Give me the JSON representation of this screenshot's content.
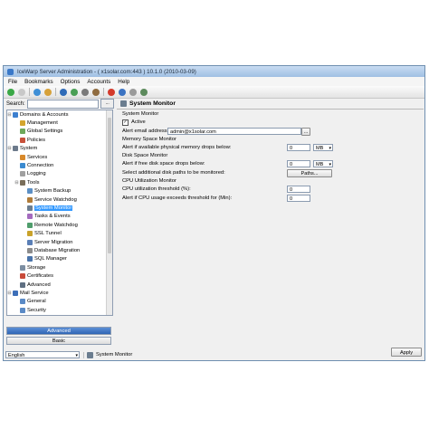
{
  "window": {
    "title": "IceWarp Server Administration - ( x1solar.com:443 ) 10.1.0 (2010-03-09)"
  },
  "menu": [
    "File",
    "Bookmarks",
    "Options",
    "Accounts",
    "Help"
  ],
  "search": {
    "label": "Search:",
    "button": "..."
  },
  "tree": [
    {
      "label": "Domains & Accounts",
      "exp": "⊟",
      "icon": "#3c7fcf",
      "indent": 0
    },
    {
      "label": "Management",
      "exp": "",
      "icon": "#d4a52e",
      "indent": 2
    },
    {
      "label": "Global Settings",
      "exp": "",
      "icon": "#6fa85a",
      "indent": 2
    },
    {
      "label": "Policies",
      "exp": "",
      "icon": "#c8513a",
      "indent": 2
    },
    {
      "label": "System",
      "exp": "⊟",
      "icon": "#6c7a8b",
      "indent": 0
    },
    {
      "label": "Services",
      "exp": "",
      "icon": "#d8892a",
      "indent": 2
    },
    {
      "label": "Connection",
      "exp": "",
      "icon": "#3a8ad0",
      "indent": 2
    },
    {
      "label": "Logging",
      "exp": "",
      "icon": "#a0a0a0",
      "indent": 2
    },
    {
      "label": "Tools",
      "exp": "⊟",
      "icon": "#7a6e5a",
      "indent": 2
    },
    {
      "label": "System Backup",
      "exp": "",
      "icon": "#5c8fc4",
      "indent": 4
    },
    {
      "label": "Service Watchdog",
      "exp": "",
      "icon": "#b07c38",
      "indent": 4
    },
    {
      "label": "System Monitor",
      "exp": "",
      "icon": "#6b7d8f",
      "indent": 4
    },
    {
      "label": "Tasks & Events",
      "exp": "",
      "icon": "#a46bbf",
      "indent": 4
    },
    {
      "label": "Remote Watchdog",
      "exp": "",
      "icon": "#4f9d6c",
      "indent": 4
    },
    {
      "label": "SSL Tunnel",
      "exp": "",
      "icon": "#c9a22a",
      "indent": 4
    },
    {
      "label": "Server Migration",
      "exp": "",
      "icon": "#5a7fb6",
      "indent": 4
    },
    {
      "label": "Database Migration",
      "exp": "",
      "icon": "#8c8c8c",
      "indent": 4
    },
    {
      "label": "SQL Manager",
      "exp": "",
      "icon": "#4a74aa",
      "indent": 4
    },
    {
      "label": "Storage",
      "exp": "",
      "icon": "#7c8ea2",
      "indent": 2
    },
    {
      "label": "Certificates",
      "exp": "",
      "icon": "#c94b3a",
      "indent": 2
    },
    {
      "label": "Advanced",
      "exp": "",
      "icon": "#5f6f82",
      "indent": 2
    },
    {
      "label": "Mail Service",
      "exp": "⊟",
      "icon": "#3d6fb8",
      "indent": 0
    },
    {
      "label": "General",
      "exp": "",
      "icon": "#5a8ac6",
      "indent": 2
    },
    {
      "label": "Security",
      "exp": "",
      "icon": "#5a8ac6",
      "indent": 2
    }
  ],
  "mode": {
    "advanced": "Advanced",
    "basic": "Basic"
  },
  "panel": {
    "title": "System Monitor",
    "sys_section": "System Monitor",
    "active_label": "Active",
    "active_checked": true,
    "email_label": "Alert email address:",
    "email_value": "admin@x1solar.com",
    "email_button": "...",
    "mem_section": "Memory Space Monitor",
    "mem_label": "Alert if available physical memory drops below:",
    "mem_value": "0",
    "mem_unit": "MB",
    "disk_section": "Disk Space Monitor",
    "disk_label": "Alert if free disk space drops below:",
    "disk_value": "0",
    "disk_unit": "MB",
    "paths_label": "Select additional disk paths to be monitored:",
    "paths_button": "Paths...",
    "cpu_section": "CPU Utilization Monitor",
    "cpu_label": "CPU utilization threshold (%):",
    "cpu_value": "0",
    "cpu_time_label": "Alert if CPU usage exceeds threshold for (Min):",
    "cpu_time_value": "0",
    "apply_button": "Apply"
  },
  "status": {
    "language": "English",
    "current": "System Monitor"
  }
}
